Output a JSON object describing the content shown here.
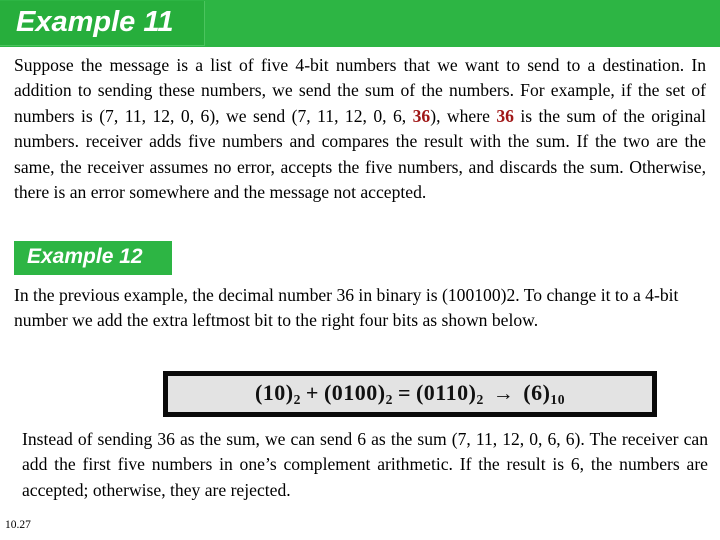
{
  "slide": {
    "number": "10.27",
    "header": {
      "title": "Example 11",
      "bar_color": "#2DB544",
      "box_color": "#27AE3C",
      "text_color": "#FFFFFF"
    },
    "paragraph_1": {
      "segment_1": "Suppose the message is a list of five 4-bit numbers that we want to send to a destination. In addition to sending these numbers, we send the sum of the numbers. For example, if the set of numbers is (7, 11, 12, 0, 6), we send (7, 11, 12, 0, 6, ",
      "highlight_1": "36",
      "segment_2": "), where ",
      "highlight_2": "36",
      "segment_3": " is the sum of the original numbers. receiver adds five numbers and compares the result with the sum. If the two are the same, the receiver assumes no error, accepts the five numbers, and discards the sum. Otherwise, there is an error somewhere and the message not accepted.",
      "highlight_color": "#A01818"
    },
    "example_12_label": {
      "title": "Example 12",
      "box_color": "#2DB544",
      "text_color": "#FFFFFF"
    },
    "paragraph_2": {
      "text": "In the previous example, the decimal number 36 in binary is (100100)2. To change it to a 4-bit number we add the extra leftmost bit to the right four bits as shown below."
    },
    "equation": {
      "term_1_base": "(10)",
      "term_1_sub": "2",
      "operator_plus": "+",
      "term_2_base": "(0100)",
      "term_2_sub": "2",
      "operator_equals": "=",
      "term_3_base": "(0110)",
      "term_3_sub": "2",
      "arrow": "→",
      "term_4_base": "(6)",
      "term_4_sub": "10",
      "background_color": "#E3E3E3",
      "border_color": "#0A0A0A"
    },
    "paragraph_3": {
      "text": "Instead of sending 36 as the sum, we can send 6 as the sum (7, 11, 12, 0, 6, 6). The receiver can add the first five numbers in one’s complement arithmetic. If the result is 6, the numbers are accepted; otherwise, they are rejected."
    }
  }
}
